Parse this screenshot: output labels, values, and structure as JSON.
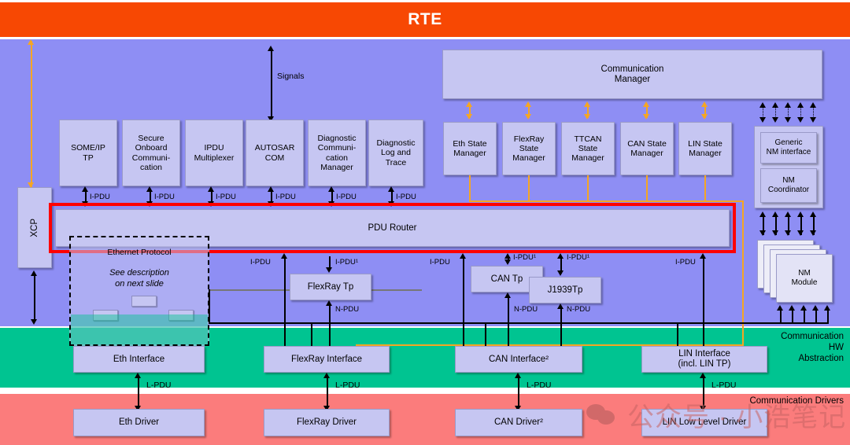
{
  "bands": {
    "rte": {
      "label": "RTE",
      "color": "#F74803"
    },
    "bsw": {
      "color": "#8E8EF4"
    },
    "hw": {
      "label": "Communication\nHW\nAbstraction",
      "label_l1": "Communication",
      "label_l2": "HW",
      "label_l3": "Abstraction",
      "color": "#00C491"
    },
    "drivers": {
      "label": "Communication Drivers",
      "color": "#FB7C7C"
    }
  },
  "services": {
    "xcp": "XCP",
    "communication_manager": {
      "l1": "Communication",
      "l2": "Manager"
    },
    "top_modules": [
      {
        "id": "some-ip-tp",
        "lines": [
          "SOME/IP",
          "TP"
        ]
      },
      {
        "id": "secure-onboard-communication",
        "lines": [
          "Secure",
          "Onboard",
          "Communi-",
          "cation"
        ]
      },
      {
        "id": "ipdu-multiplexer",
        "lines": [
          "IPDU",
          "Multiplexer"
        ]
      },
      {
        "id": "autosar-com",
        "lines": [
          "AUTOSAR",
          "COM"
        ]
      },
      {
        "id": "diagnostic-communication-manager",
        "lines": [
          "Diagnostic",
          "Communi-",
          "cation",
          "Manager"
        ]
      },
      {
        "id": "diagnostic-log-and-trace",
        "lines": [
          "Diagnostic",
          "Log and",
          "Trace"
        ]
      }
    ],
    "state_managers": [
      {
        "id": "eth-state-manager",
        "lines": [
          "Eth State",
          "Manager"
        ]
      },
      {
        "id": "flexray-state-manager",
        "lines": [
          "FlexRay",
          "State",
          "Manager"
        ]
      },
      {
        "id": "ttcan-state-manager",
        "lines": [
          "TTCAN",
          "State",
          "Manager"
        ]
      },
      {
        "id": "can-state-manager",
        "lines": [
          "CAN State",
          "Manager"
        ]
      },
      {
        "id": "lin-state-manager",
        "lines": [
          "LIN State",
          "Manager"
        ]
      }
    ],
    "nm": {
      "generic_nm_interface": {
        "l1": "Generic",
        "l2": "NM interface"
      },
      "nm_coordinator": {
        "l1": "NM",
        "l2": "Coordinator"
      },
      "nm_module": {
        "l1": "NM",
        "l2": "Module"
      }
    },
    "pdu_router": "PDU Router",
    "transport_protocols": [
      {
        "id": "flexray-tp",
        "label": "FlexRay Tp"
      },
      {
        "id": "can-tp",
        "label": "CAN Tp"
      },
      {
        "id": "j1939-tp",
        "label": "J1939Tp"
      }
    ],
    "ethernet_protocol": {
      "title": "Ethernet Protocol",
      "note_l1": "See description",
      "note_l2": "on next slide"
    }
  },
  "interfaces": [
    {
      "id": "eth-interface",
      "l1": "Eth Interface",
      "l2": ""
    },
    {
      "id": "flexray-interface",
      "l1": "FlexRay Interface",
      "l2": ""
    },
    {
      "id": "can-interface",
      "l1": "CAN Interface²",
      "l2": ""
    },
    {
      "id": "lin-interface",
      "l1": "LIN Interface",
      "l2": "(incl. LIN TP)"
    }
  ],
  "drivers": [
    {
      "id": "eth-driver",
      "label": "Eth Driver"
    },
    {
      "id": "flexray-driver",
      "label": "FlexRay Driver"
    },
    {
      "id": "can-driver",
      "label": "CAN Driver²"
    },
    {
      "id": "lin-low-level-driver",
      "label": "LIN Low Level Driver"
    }
  ],
  "edge_labels": {
    "signals": "Signals",
    "ipdu": "I-PDU",
    "ipdu_1": "I-PDU¹",
    "npdu": "N-PDU",
    "lpdu": "L-PDU"
  },
  "watermark": {
    "text": "公众号 · 小浩笔记"
  }
}
